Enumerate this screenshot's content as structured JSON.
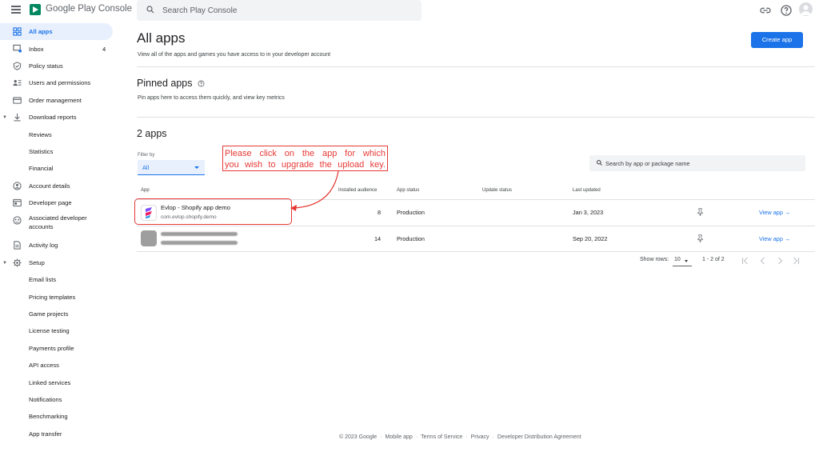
{
  "header": {
    "brand": "Google Play Console",
    "search_placeholder": "Search Play Console",
    "icons": [
      "menu-icon",
      "play-console-logo",
      "search-icon",
      "link-icon",
      "help-icon",
      "avatar"
    ]
  },
  "sidebar": {
    "items": [
      {
        "label": "All apps",
        "icon": "grid-icon",
        "active": true
      },
      {
        "label": "Inbox",
        "icon": "inbox-icon",
        "count": "4"
      },
      {
        "label": "Policy status",
        "icon": "shield-icon"
      },
      {
        "label": "Users and permissions",
        "icon": "people-icon"
      },
      {
        "label": "Order management",
        "icon": "card-icon"
      },
      {
        "label": "Download reports",
        "icon": "download-icon",
        "expanded": true
      },
      {
        "label": "Reviews"
      },
      {
        "label": "Statistics"
      },
      {
        "label": "Financial"
      },
      {
        "label": "Account details",
        "icon": "account-icon"
      },
      {
        "label": "Developer page",
        "icon": "page-icon"
      },
      {
        "label": "Associated developer accounts",
        "icon": "link-accounts-icon"
      },
      {
        "label": "Activity log",
        "icon": "log-icon"
      },
      {
        "label": "Setup",
        "icon": "gear-icon",
        "expanded": true
      },
      {
        "label": "Email lists"
      },
      {
        "label": "Pricing templates"
      },
      {
        "label": "Game projects"
      },
      {
        "label": "License testing"
      },
      {
        "label": "Payments profile"
      },
      {
        "label": "API access"
      },
      {
        "label": "Linked services"
      },
      {
        "label": "Notifications"
      },
      {
        "label": "Benchmarking"
      },
      {
        "label": "App transfer"
      }
    ]
  },
  "main": {
    "title": "All apps",
    "subtitle": "View all of the apps and games you have access to in your developer account",
    "create_button": "Create app",
    "pinned_title": "Pinned apps",
    "pinned_subtitle": "Pin apps here to access them quickly, and view key metrics",
    "apps_count_title": "2 apps",
    "filter_label": "Filter by",
    "filter_value": "All",
    "app_search_placeholder": "Search by app or package name",
    "columns": [
      "App",
      "Installed audience",
      "App status",
      "Update status",
      "Last updated"
    ],
    "rows": [
      {
        "name": "Evlop - Shopify app demo",
        "package": "com.evlop.shopify.demo",
        "audience": "8",
        "status": "Production",
        "update_status": "",
        "last_updated": "Jan 3, 2023",
        "action": "View app"
      },
      {
        "name": "",
        "package": "",
        "audience": "14",
        "status": "Production",
        "update_status": "",
        "last_updated": "Sep 20, 2022",
        "action": "View app"
      }
    ],
    "pager": {
      "rows_label": "Show rows:",
      "rows_value": "10",
      "range": "1 - 2 of 2"
    }
  },
  "annotation": {
    "line1": "Please click on the app for which",
    "line2": "you wish to upgrade the upload key.",
    "color": "#e53935"
  },
  "footer": {
    "copyright": "© 2023 Google",
    "links": [
      "Mobile app",
      "Terms of Service",
      "Privacy",
      "Developer Distribution Agreement"
    ]
  },
  "colors": {
    "accent": "#1a73e8",
    "active_bg": "#e8f0fe",
    "annotation": "#e53935"
  }
}
